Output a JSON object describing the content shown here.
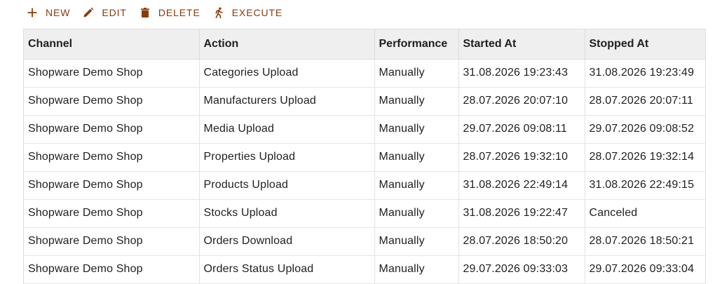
{
  "toolbar": {
    "new_label": "NEW",
    "edit_label": "EDIT",
    "delete_label": "DELETE",
    "execute_label": "EXECUTE",
    "icons": [
      "plus-icon",
      "pencil-icon",
      "trash-icon",
      "running-person-icon"
    ],
    "accent_color": "#8a3a0a"
  },
  "table": {
    "columns": [
      "Channel",
      "Action",
      "Performance",
      "Started At",
      "Stopped At"
    ],
    "rows": [
      [
        "Shopware Demo Shop",
        "Categories Upload",
        "Manually",
        "31.08.2026 19:23:43",
        "31.08.2026 19:23:49"
      ],
      [
        "Shopware Demo Shop",
        "Manufacturers Upload",
        "Manually",
        "28.07.2026 20:07:10",
        "28.07.2026 20:07:11"
      ],
      [
        "Shopware Demo Shop",
        "Media Upload",
        "Manually",
        "29.07.2026 09:08:11",
        "29.07.2026 09:08:52"
      ],
      [
        "Shopware Demo Shop",
        "Properties Upload",
        "Manually",
        "28.07.2026 19:32:10",
        "28.07.2026 19:32:14"
      ],
      [
        "Shopware Demo Shop",
        "Products Upload",
        "Manually",
        "31.08.2026 22:49:14",
        "31.08.2026 22:49:15"
      ],
      [
        "Shopware Demo Shop",
        "Stocks Upload",
        "Manually",
        "31.08.2026 19:22:47",
        "Canceled"
      ],
      [
        "Shopware Demo Shop",
        "Orders Download",
        "Manually",
        "28.07.2026 18:50:20",
        "28.07.2026 18:50:21"
      ],
      [
        "Shopware Demo Shop",
        "Orders Status Upload",
        "Manually",
        "29.07.2026 09:33:03",
        "29.07.2026 09:33:04"
      ]
    ]
  }
}
